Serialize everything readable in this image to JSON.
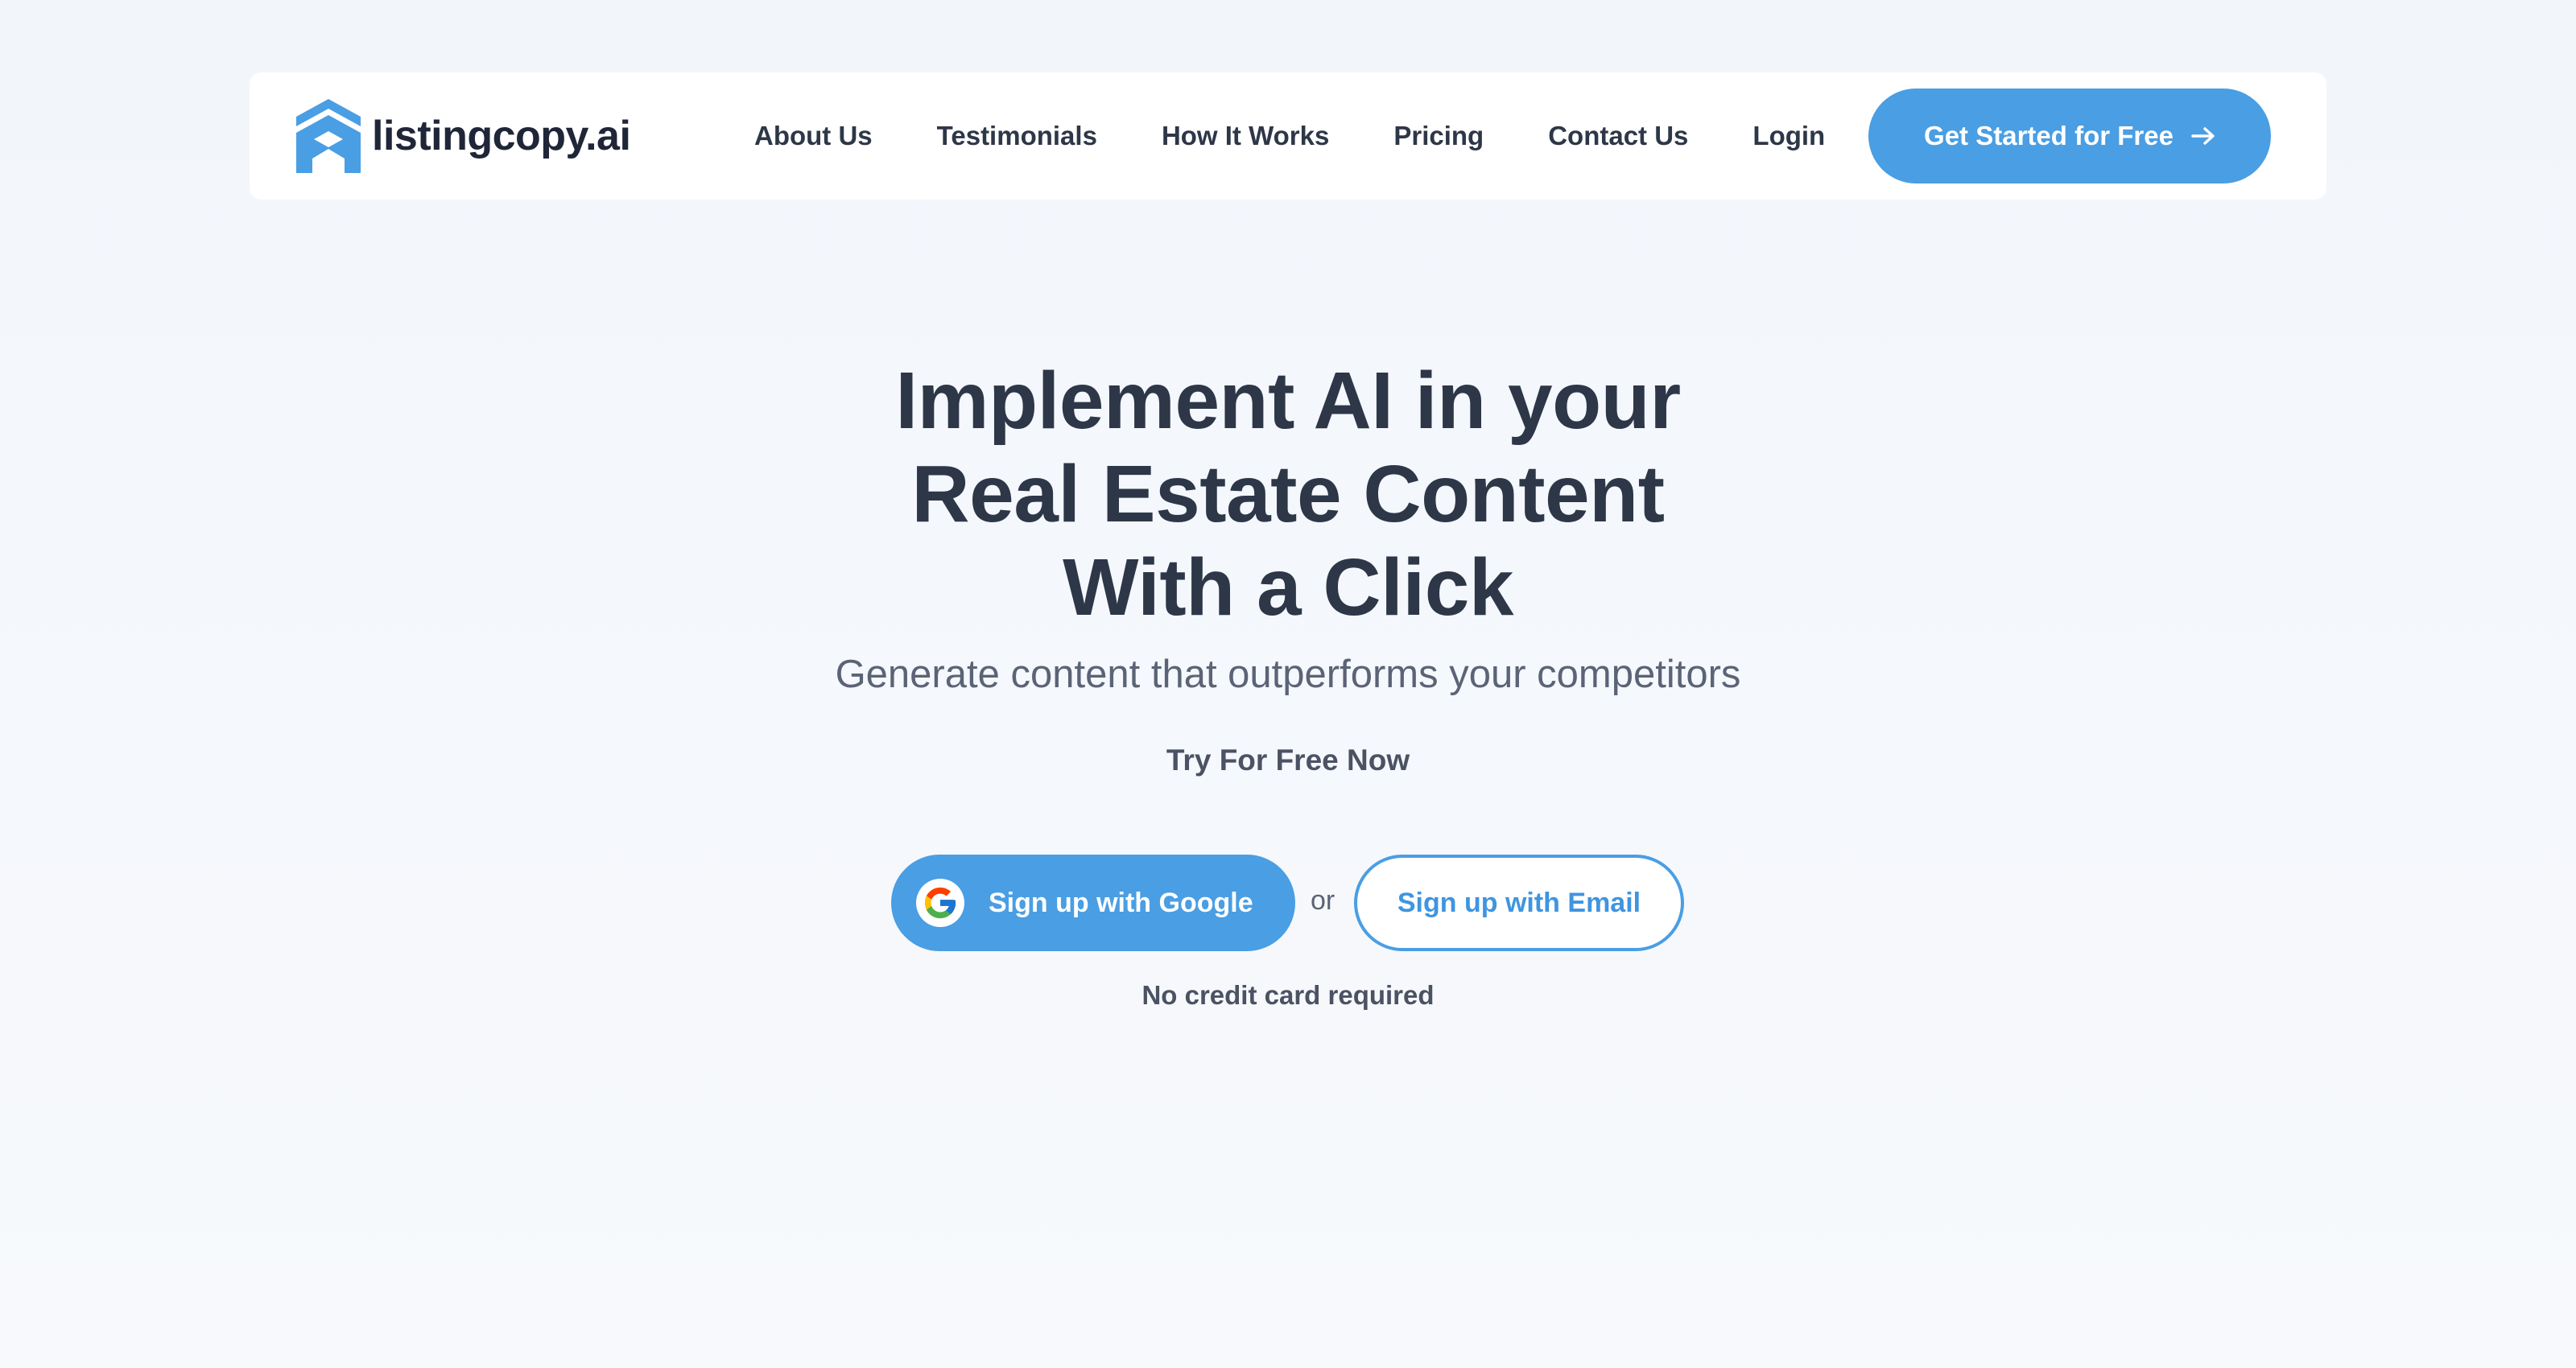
{
  "brand": {
    "name": "listingcopy.ai",
    "accent": "#4a9ee3"
  },
  "nav": {
    "links": [
      "About Us",
      "Testimonials",
      "How It Works",
      "Pricing",
      "Contact Us",
      "Login"
    ],
    "cta_label": "Get Started for Free",
    "cta_icon": "arrow-right-icon"
  },
  "hero": {
    "headline_lines": [
      "Implement AI in your",
      "Real Estate Content",
      "With a Click"
    ],
    "subheadline": "Generate content that outperforms your competitors",
    "try_label": "Try For Free Now",
    "google_button": "Sign up with Google",
    "google_icon": "google-icon",
    "or_text": "or",
    "email_button": "Sign up with Email",
    "note": "No credit card required"
  }
}
